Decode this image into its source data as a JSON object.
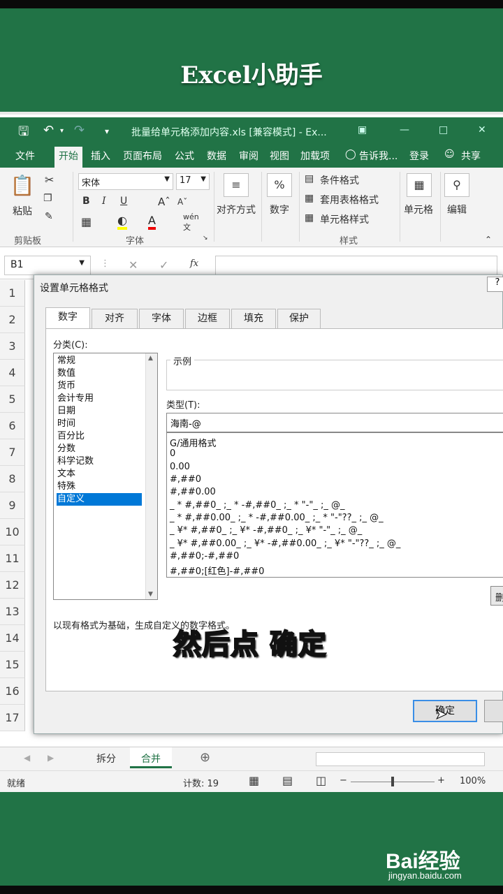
{
  "video_title": "Excel小助手",
  "window": {
    "doc_title": "批量给单元格添加内容.xls  [兼容模式] - Ex...",
    "quick_access": {
      "save_icon": "save-icon",
      "undo_icon": "undo-icon"
    }
  },
  "ribbon_tabs": [
    "文件",
    "开始",
    "插入",
    "页面布局",
    "公式",
    "数据",
    "审阅",
    "视图",
    "加载项",
    "告诉我...",
    "登录",
    "共享"
  ],
  "active_tab": "开始",
  "ribbon": {
    "paste": "粘贴",
    "clipboard_group": "剪贴板",
    "font_name": "宋体",
    "font_size": "17",
    "bold": "B",
    "italic": "I",
    "underline": "U",
    "font_group": "字体",
    "align": "对齐方式",
    "number": "数字",
    "conditional": "条件格式",
    "table_format": "套用表格格式",
    "cell_style": "单元格样式",
    "style_group": "样式",
    "cells": "单元格",
    "edit": "编辑"
  },
  "formula_bar": {
    "name_box": "B1",
    "fx": "fx"
  },
  "row_numbers": [
    "1",
    "2",
    "3",
    "4",
    "5",
    "6",
    "7",
    "8",
    "9",
    "10",
    "11",
    "12",
    "13",
    "14",
    "15",
    "16",
    "17"
  ],
  "dialog": {
    "title": "设置单元格格式",
    "tabs": [
      "数字",
      "对齐",
      "字体",
      "边框",
      "填充",
      "保护"
    ],
    "active_tab": "数字",
    "category_label": "分类(C):",
    "categories": [
      "常规",
      "数值",
      "货币",
      "会计专用",
      "日期",
      "时间",
      "百分比",
      "分数",
      "科学记数",
      "文本",
      "特殊",
      "自定义"
    ],
    "selected_category": "自定义",
    "sample_label": "示例",
    "type_label": "类型(T):",
    "type_value": "海南-@",
    "formats": [
      "G/通用格式",
      "0",
      "0.00",
      "#,##0",
      "#,##0.00",
      "_ * #,##0_ ;_ * -#,##0_ ;_ * \"-\"_ ;_ @_",
      "_ * #,##0.00_ ;_ * -#,##0.00_ ;_ * \"-\"??_ ;_ @_",
      "_ ¥* #,##0_ ;_ ¥* -#,##0_ ;_ ¥* \"-\"_ ;_ @_",
      "_ ¥* #,##0.00_ ;_ ¥* -#,##0.00_ ;_ ¥* \"-\"??_ ;_ @_",
      "#,##0;-#,##0",
      "#,##0;[红色]-#,##0"
    ],
    "delete_button": "删除",
    "description": "以现有格式为基础，生成自定义的数字格式。",
    "ok_button": "确定"
  },
  "sheets": [
    "拆分",
    "合并"
  ],
  "active_sheet": "合并",
  "status": {
    "ready": "就绪",
    "count": "计数: 19",
    "zoom": "100%"
  },
  "subtitle": "然后点 确定",
  "watermark": {
    "brand": "Bai经验",
    "url": "jingyan.baidu.com"
  },
  "colors": {
    "excel_green": "#217346",
    "selection_blue": "#0078d7"
  }
}
